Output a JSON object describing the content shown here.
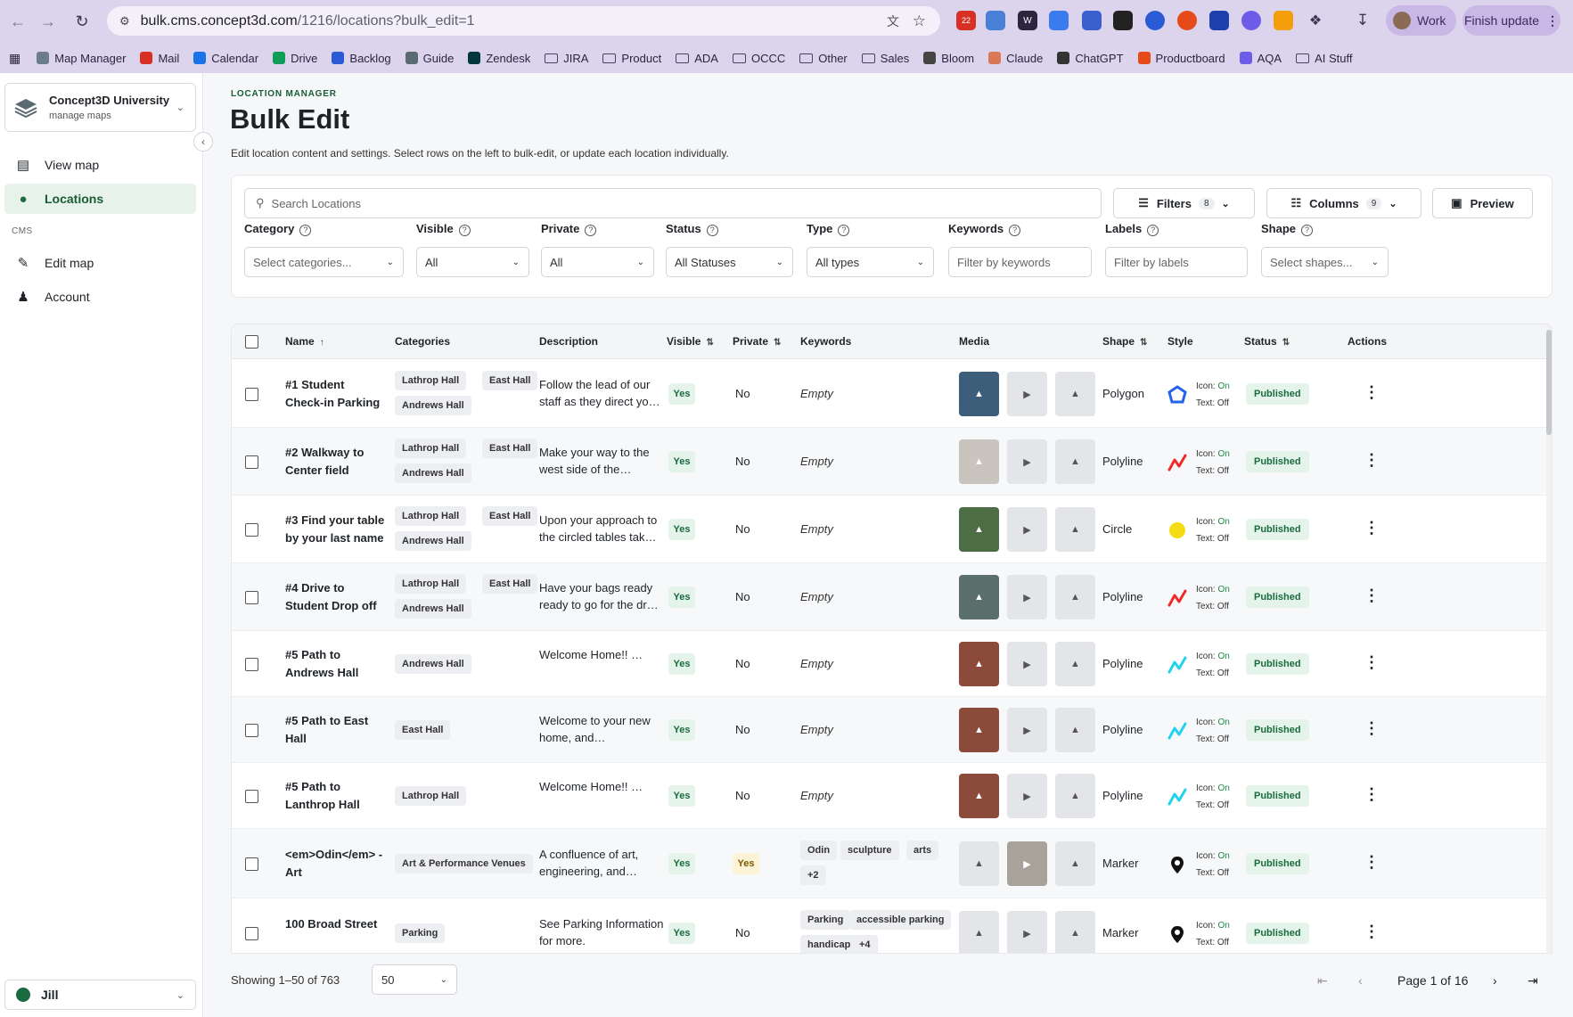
{
  "browser": {
    "url_host": "bulk.cms.concept3d.com",
    "url_path": "/1216/locations?bulk_edit=1",
    "calendar_badge": "22",
    "profile_label": "Work",
    "finish_update_label": "Finish update",
    "bookmarks": [
      {
        "label": "Map Manager",
        "icon": "map-icon"
      },
      {
        "label": "Mail",
        "icon": "mail-icon"
      },
      {
        "label": "Calendar",
        "icon": "calendar-icon"
      },
      {
        "label": "Drive",
        "icon": "drive-icon"
      },
      {
        "label": "Backlog",
        "icon": "backlog-icon"
      },
      {
        "label": "Guide",
        "icon": "guide-icon"
      },
      {
        "label": "Zendesk",
        "icon": "zendesk-icon"
      },
      {
        "label": "JIRA",
        "icon": "folder-icon"
      },
      {
        "label": "Product",
        "icon": "folder-icon"
      },
      {
        "label": "ADA",
        "icon": "folder-icon"
      },
      {
        "label": "OCCC",
        "icon": "folder-icon"
      },
      {
        "label": "Other",
        "icon": "folder-icon"
      },
      {
        "label": "Sales",
        "icon": "folder-icon"
      },
      {
        "label": "Bloom",
        "icon": "bloom-icon"
      },
      {
        "label": "Claude",
        "icon": "claude-icon"
      },
      {
        "label": "ChatGPT",
        "icon": "chatgpt-icon"
      },
      {
        "label": "Productboard",
        "icon": "productboard-icon"
      },
      {
        "label": "AQA",
        "icon": "aqa-icon"
      },
      {
        "label": "AI Stuff",
        "icon": "folder-icon"
      }
    ]
  },
  "sidebar": {
    "org_name": "Concept3D University",
    "org_sub": "manage maps",
    "items": [
      {
        "label": "View map",
        "icon": "map-icon"
      },
      {
        "label": "Locations",
        "icon": "pin-icon"
      }
    ],
    "section_label": "CMS",
    "cms_items": [
      {
        "label": "Edit map",
        "icon": "pencil-icon"
      },
      {
        "label": "Account",
        "icon": "user-gear-icon"
      }
    ],
    "user_name": "Jill"
  },
  "header": {
    "kicker": "LOCATION MANAGER",
    "title": "Bulk Edit",
    "subtitle": "Edit location content and settings. Select rows on the left to bulk-edit, or update each location individually."
  },
  "toolbar": {
    "search_placeholder": "Search Locations",
    "filters_label": "Filters",
    "filters_count": "8",
    "columns_label": "Columns",
    "columns_count": "9",
    "preview_label": "Preview"
  },
  "filters": [
    {
      "label": "Category",
      "value": "Select categories...",
      "placeholder": true
    },
    {
      "label": "Visible",
      "value": "All",
      "placeholder": false
    },
    {
      "label": "Private",
      "value": "All",
      "placeholder": false
    },
    {
      "label": "Status",
      "value": "All Statuses",
      "placeholder": false
    },
    {
      "label": "Type",
      "value": "All types",
      "placeholder": false
    },
    {
      "label": "Keywords",
      "value": "Filter by keywords",
      "placeholder": true
    },
    {
      "label": "Labels",
      "value": "Filter by labels",
      "placeholder": true
    },
    {
      "label": "Shape",
      "value": "Select shapes...",
      "placeholder": true
    }
  ],
  "table": {
    "columns": [
      "Name",
      "Categories",
      "Description",
      "Visible",
      "Private",
      "Keywords",
      "Media",
      "Shape",
      "Style",
      "Status",
      "Actions"
    ],
    "rows": [
      {
        "name": "#1 Student Check-in Parking",
        "categories": [
          "Lathrop Hall",
          "East Hall",
          "Andrews Hall"
        ],
        "description": "Follow the lead of our staff as they direct yo…",
        "visible": "Yes",
        "private": "No",
        "keywords": [],
        "keywords_empty": "Empty",
        "media_thumb": true,
        "shape": "Polygon",
        "style_shape": "polygon",
        "style_color": "#2563eb",
        "icon_label": "Icon:",
        "icon_state": "On",
        "text_label": "Text:",
        "text_state": "Off",
        "status": "Published"
      },
      {
        "name": "#2 Walkway to Center field",
        "categories": [
          "Lathrop Hall",
          "East Hall",
          "Andrews Hall"
        ],
        "description": "Make your way to the west side of the…",
        "visible": "Yes",
        "private": "No",
        "keywords": [],
        "keywords_empty": "Empty",
        "media_thumb": true,
        "shape": "Polyline",
        "style_shape": "polyline",
        "style_color": "#ef2b2b",
        "icon_label": "Icon:",
        "icon_state": "On",
        "text_label": "Text:",
        "text_state": "Off",
        "status": "Published"
      },
      {
        "name": "#3 Find your table by your last name",
        "categories": [
          "Lathrop Hall",
          "East Hall",
          "Andrews Hall"
        ],
        "description": "Upon your approach to the circled tables tak…",
        "visible": "Yes",
        "private": "No",
        "keywords": [],
        "keywords_empty": "Empty",
        "media_thumb": true,
        "shape": "Circle",
        "style_shape": "circle",
        "style_color": "#f5dc14",
        "icon_label": "Icon:",
        "icon_state": "On",
        "text_label": "Text:",
        "text_state": "Off",
        "status": "Published"
      },
      {
        "name": "#4 Drive to Student Drop off",
        "categories": [
          "Lathrop Hall",
          "East Hall",
          "Andrews Hall"
        ],
        "description": "Have your bags ready ready to go for the dr…",
        "visible": "Yes",
        "private": "No",
        "keywords": [],
        "keywords_empty": "Empty",
        "media_thumb": true,
        "shape": "Polyline",
        "style_shape": "polyline",
        "style_color": "#ef2b2b",
        "icon_label": "Icon:",
        "icon_state": "On",
        "text_label": "Text:",
        "text_state": "Off",
        "status": "Published"
      },
      {
        "name": "#5 Path to Andrews Hall",
        "categories": [
          "Andrews Hall"
        ],
        "description": "Welcome Home!! …",
        "visible": "Yes",
        "private": "No",
        "keywords": [],
        "keywords_empty": "Empty",
        "media_thumb": true,
        "shape": "Polyline",
        "style_shape": "polyline",
        "style_color": "#22d3ee",
        "icon_label": "Icon:",
        "icon_state": "On",
        "text_label": "Text:",
        "text_state": "Off",
        "status": "Published"
      },
      {
        "name": "#5 Path to East Hall",
        "categories": [
          "East Hall"
        ],
        "description": "Welcome to your new home, and…",
        "visible": "Yes",
        "private": "No",
        "keywords": [],
        "keywords_empty": "Empty",
        "media_thumb": true,
        "shape": "Polyline",
        "style_shape": "polyline",
        "style_color": "#22d3ee",
        "icon_label": "Icon:",
        "icon_state": "On",
        "text_label": "Text:",
        "text_state": "Off",
        "status": "Published"
      },
      {
        "name": "#5 Path to Lanthrop Hall",
        "categories": [
          "Lathrop Hall"
        ],
        "description": "Welcome Home!! …",
        "visible": "Yes",
        "private": "No",
        "keywords": [],
        "keywords_empty": "Empty",
        "media_thumb": true,
        "shape": "Polyline",
        "style_shape": "polyline",
        "style_color": "#22d3ee",
        "icon_label": "Icon:",
        "icon_state": "On",
        "text_label": "Text:",
        "text_state": "Off",
        "status": "Published"
      },
      {
        "name": "<em>Odin</em> - Art",
        "categories": [
          "Art & Performance Venues"
        ],
        "description": "A confluence of art, engineering, and…",
        "visible": "Yes",
        "private": "Yes",
        "keywords": [
          "Odin",
          "sculpture",
          "arts",
          "+2"
        ],
        "keywords_empty": "",
        "media_thumb": false,
        "shape": "Marker",
        "style_shape": "marker",
        "style_color": "#111111",
        "icon_label": "Icon:",
        "icon_state": "On",
        "text_label": "Text:",
        "text_state": "Off",
        "status": "Published"
      },
      {
        "name": "100 Broad Street",
        "categories": [
          "Parking"
        ],
        "description": "See Parking Information for more.",
        "visible": "Yes",
        "private": "No",
        "keywords": [
          "Parking",
          "accessible parking",
          "handicap",
          "+4"
        ],
        "keywords_empty": "",
        "media_thumb": false,
        "shape": "Marker",
        "style_shape": "marker",
        "style_color": "#111111",
        "icon_label": "Icon:",
        "icon_state": "On",
        "text_label": "Text:",
        "text_state": "Off",
        "status": "Published"
      }
    ]
  },
  "footer": {
    "showing": "Showing 1–50 of 763",
    "page_size": "50",
    "page_label": "Page 1 of 16"
  }
}
